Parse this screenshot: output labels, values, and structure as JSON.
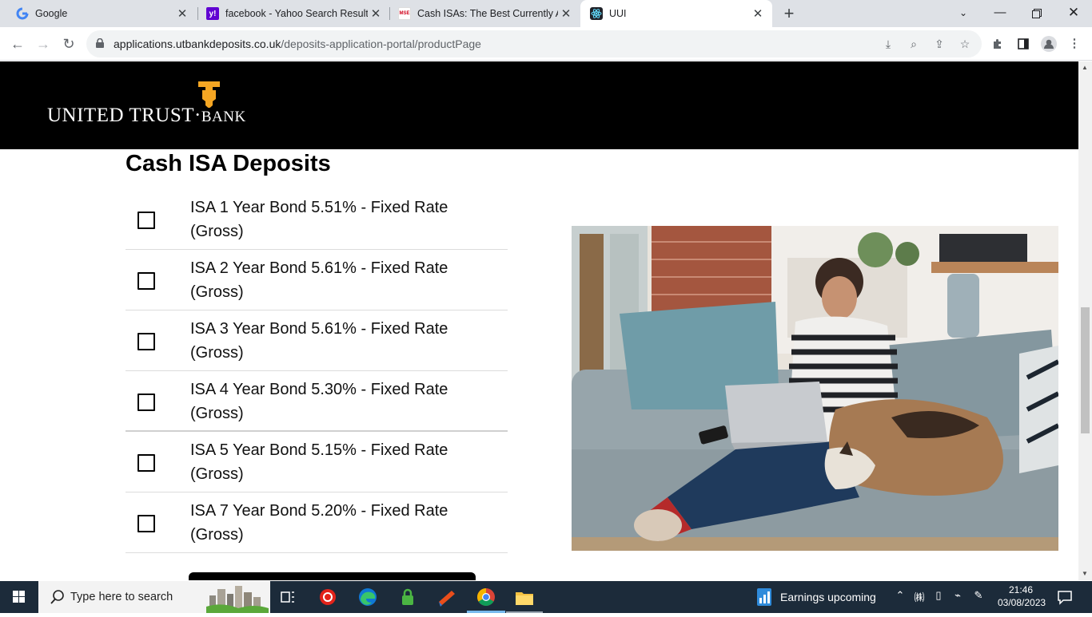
{
  "browser": {
    "tabs": [
      {
        "title": "Google",
        "favicon": "google-icon",
        "active": false
      },
      {
        "title": "facebook - Yahoo Search Results",
        "favicon": "yahoo-icon",
        "active": false
      },
      {
        "title": "Cash ISAs: The Best Currently Ava",
        "favicon": "mse-icon",
        "favicon_text": "MSE",
        "active": false
      },
      {
        "title": "UUI",
        "favicon": "react-icon",
        "active": true
      }
    ],
    "new_tab_label": "+",
    "url_host": "applications.utbankdeposits.co.uk",
    "url_path": "/deposits-application-portal/productPage"
  },
  "header": {
    "logo_text_main": "UNITED TRUST",
    "logo_text_dot": "·",
    "logo_text_end": "BANK",
    "logo_color": "#f5a623"
  },
  "main": {
    "title": "Cash ISA Deposits",
    "products": [
      {
        "label": "ISA 1 Year Bond 5.51% - Fixed Rate (Gross)",
        "checked": false
      },
      {
        "label": "ISA 2 Year Bond 5.61% - Fixed Rate (Gross)",
        "checked": false
      },
      {
        "label": "ISA 3 Year Bond 5.61% - Fixed Rate (Gross)",
        "checked": false
      },
      {
        "label": "ISA 4 Year Bond 5.30% - Fixed Rate (Gross)",
        "checked": false
      },
      {
        "label": "ISA 5 Year Bond 5.15% - Fixed Rate (Gross)",
        "checked": false
      },
      {
        "label": "ISA 7 Year Bond 5.20% - Fixed Rate (Gross)",
        "checked": false
      }
    ]
  },
  "taskbar": {
    "search_placeholder": "Type here to search",
    "news_label": "Earnings upcoming",
    "time": "21:46",
    "date": "03/08/2023",
    "accent": "#76b9ed"
  }
}
